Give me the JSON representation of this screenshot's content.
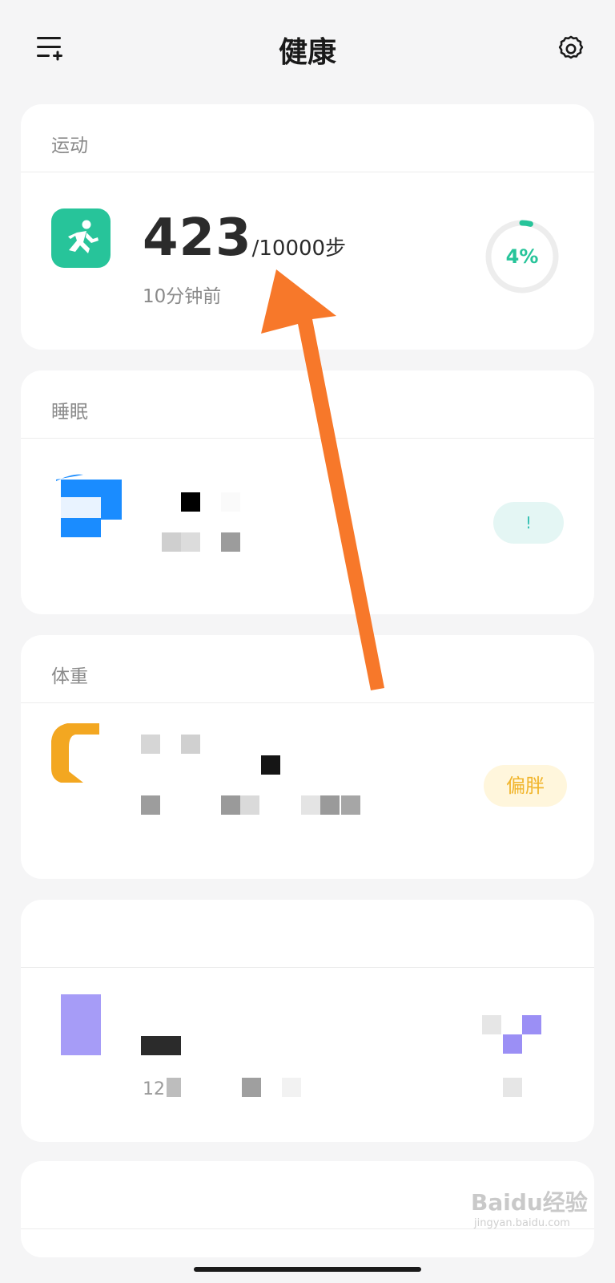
{
  "header": {
    "title": "健康",
    "menu_icon": "add-list-icon",
    "settings_icon": "gear-icon"
  },
  "exercise": {
    "section_label": "运动",
    "icon": "running-icon",
    "steps": "423",
    "goal": "/10000步",
    "updated": "10分钟前",
    "progress_text": "4%",
    "progress": 0.04,
    "accent_color": "#27c49a"
  },
  "sleep": {
    "section_label": "睡眠",
    "icon": "sleep-icon",
    "badge": "!"
  },
  "weight": {
    "section_label": "体重",
    "icon": "weight-icon",
    "badge": "偏胖"
  },
  "fourth": {
    "time_prefix": "12:"
  },
  "watermark": {
    "brand": "Baidu经验",
    "url": "jingyan.baidu.com"
  }
}
